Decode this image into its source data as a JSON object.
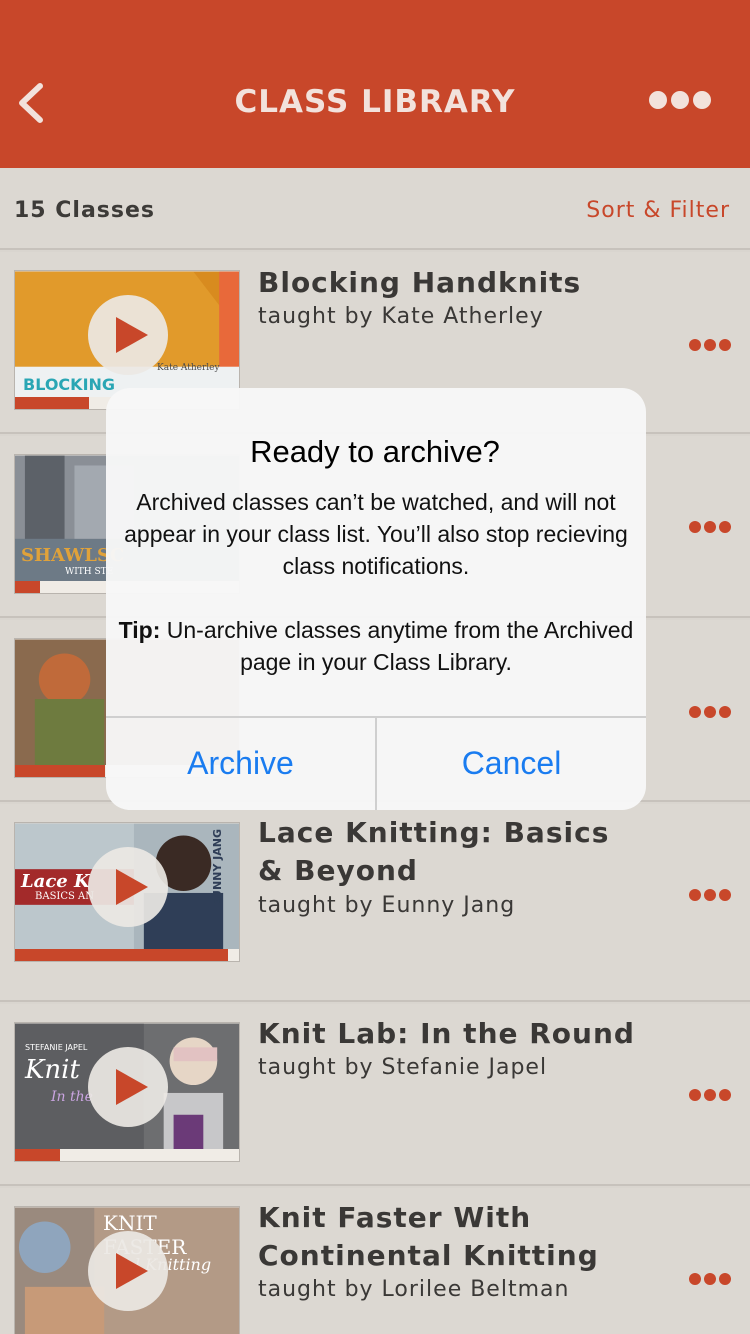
{
  "header": {
    "title": "CLASS LIBRARY",
    "back_icon": "chevron-left-icon",
    "menu_icon": "more-horizontal-icon"
  },
  "subbar": {
    "count_label": "15 Classes",
    "sort_label": "Sort & Filter"
  },
  "classes": [
    {
      "title": "Blocking Handknits",
      "teacher": "taught by Kate Atherley",
      "thumb_text": "BLOCKING",
      "thumb_small": "Kate Atherley",
      "progress": 0.33
    },
    {
      "title": "",
      "teacher": "",
      "thumb_text": "SHAWLSC",
      "thumb_small": "WITH STE",
      "progress": 0.11
    },
    {
      "title": "",
      "teacher": "",
      "thumb_text": "",
      "thumb_small": "",
      "progress": 0.4
    },
    {
      "title": "Lace Knitting: Basics & Beyond",
      "teacher": "taught by Eunny Jang",
      "thumb_text": "Lace K",
      "thumb_small": "BASICS AN",
      "thumb_side": "EUNNY JANG",
      "progress": 0.95
    },
    {
      "title": "Knit Lab: In the Round",
      "teacher": "taught by Stefanie Japel",
      "thumb_text": "Knit",
      "thumb_small": "STEFANIE JAPEL",
      "thumb_sub": "In the",
      "progress": 0.2
    },
    {
      "title": "Knit Faster With Continental Knitting",
      "teacher": "taught by Lorilee Beltman",
      "thumb_text": "KNIT FASTER",
      "thumb_sub": "l Knitting",
      "progress": 0.0
    }
  ],
  "dialog": {
    "title": "Ready to archive?",
    "message": "Archived classes can’t be watched, and will not appear in your class list. You’ll also stop recieving class notifications.",
    "tip_label": "Tip:",
    "tip_text": " Un-archive classes anytime from the Archived page in your Class Library.",
    "archive_label": "Archive",
    "cancel_label": "Cancel"
  },
  "colors": {
    "brand": "#c8472a",
    "link_blue": "#1a7cf0",
    "background": "#dcd8d2"
  }
}
